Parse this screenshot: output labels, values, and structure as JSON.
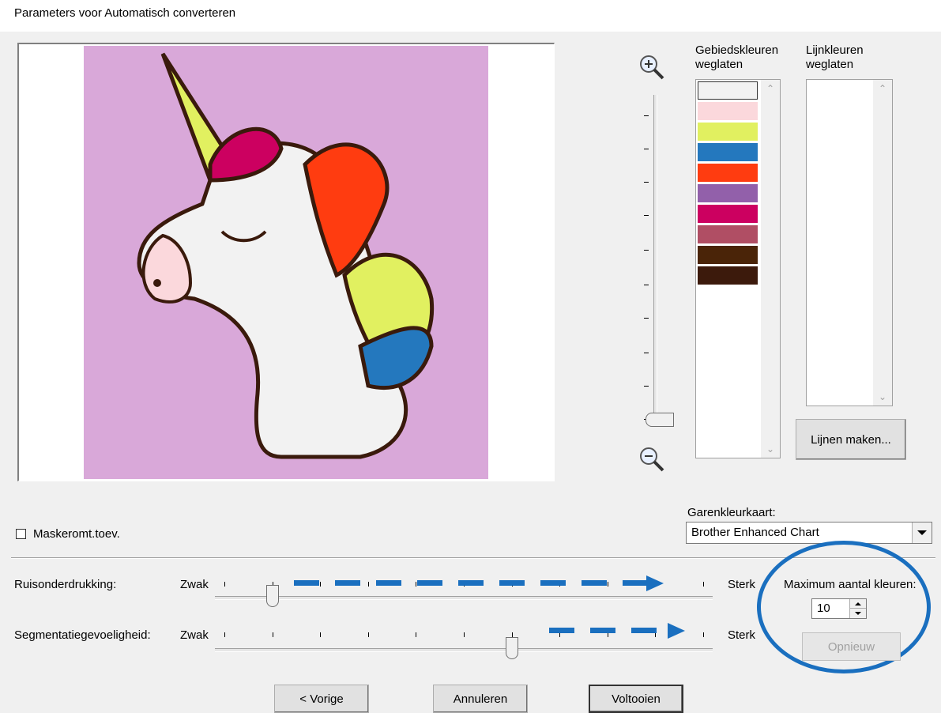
{
  "window": {
    "title": "Parameters voor Automatisch converteren"
  },
  "lists": {
    "area_colors_label": "Gebiedskleuren weglaten",
    "line_colors_label": "Lijnkleuren weglaten",
    "area_swatches": [
      "#f2f2f2",
      "#fbd8dc",
      "#e1f060",
      "#2478be",
      "#ff3c10",
      "#9260aa",
      "#cc0060",
      "#b04e64",
      "#4a2408",
      "#3c1a0c"
    ]
  },
  "buttons": {
    "make_lines": "Lijnen maken...",
    "previous": "< Vorige",
    "cancel": "Annuleren",
    "finish": "Voltooien",
    "reset": "Opnieuw"
  },
  "mask": {
    "label": "Maskeromt.toev.",
    "checked": false
  },
  "thread_chart": {
    "label": "Garenkleurkaart:",
    "value": "Brother Enhanced Chart"
  },
  "sliders": {
    "noise_label": "Ruisonderdrukking:",
    "segment_label": "Segmentatiegevoeligheid:",
    "weak": "Zwak",
    "strong": "Sterk",
    "noise_value": 1,
    "segment_value": 6,
    "steps": 11
  },
  "max_colors": {
    "label": "Maximum aantal kleuren:",
    "value": "10"
  },
  "colors": {
    "accent": "#1a6fbf",
    "preview_bg": "#d9a8d9"
  }
}
